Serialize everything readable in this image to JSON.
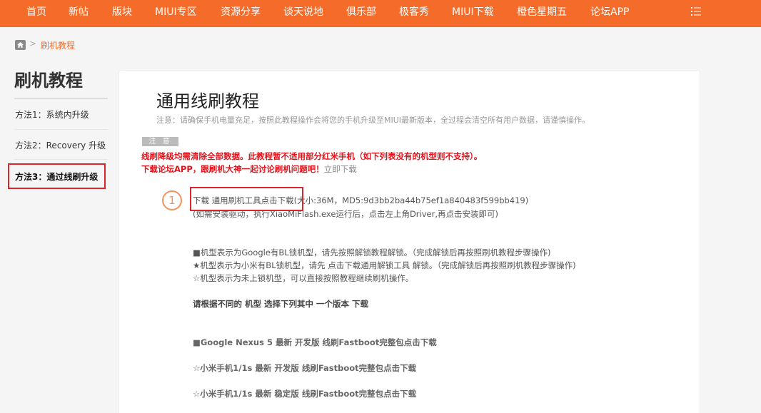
{
  "nav": {
    "items": [
      "首页",
      "新帖",
      "版块",
      "MIUI专区",
      "资源分享",
      "谈天说地",
      "俱乐部",
      "极客秀",
      "MIUI下载",
      "橙色星期五",
      "论坛APP"
    ],
    "menu_icon": "menu-list-icon"
  },
  "breadcrumb": {
    "home_icon": "home-icon",
    "separator": ">",
    "current": "刷机教程"
  },
  "sidebar": {
    "title": "刷机教程",
    "items": [
      {
        "label": "方法1：系统内升级"
      },
      {
        "label": "方法2：Recovery 升级"
      },
      {
        "label": "方法3：通过线刷升级"
      }
    ]
  },
  "main": {
    "title": "通用线刷教程",
    "notice": "注意：请确保手机电量充足，按照此教程操作会将您的手机升级至MIUI最新版本，全过程会清空所有用户数据，请谨慎操作。",
    "badge": "注 意",
    "warning_1": "线刷降级均需清除全部数据。此教程暂不适用部分红米手机（如下列表没有的机型则不支持）。",
    "warning_2_text": "下载论坛APP，跟刷机大神一起讨论刷机问题吧！",
    "warning_2_link": "立即下载",
    "step_number": "1",
    "step_line_1_prefix": "下载 ",
    "step_line_1_link": "通用刷机工具点击下载",
    "step_line_1_suffix": "(大小:36M，MD5:9d3bb2ba44b75ef1a840483f599bb419)",
    "step_line_2": "(如需安装驱动，执行XiaoMiFlash.exe运行后，点击左上角Driver,再点击安装即可)",
    "lock_1_prefix": "■机型表示为Google有BL锁机型，请先按照",
    "lock_1_link": "解锁教程",
    "lock_1_suffix": "解锁。（完成解锁后再按照刷机教程步骤操作)",
    "lock_2_prefix": "★机型表示为小米有BL锁机型，请先 ",
    "lock_2_link": "点击下载通用解锁工具",
    "lock_2_suffix": " 解锁。（完成解锁后再按照刷机教程步骤操作)",
    "lock_3": "☆机型表示为未上锁机型，可以直接按照教程继续刷机操作。",
    "choose": "请根据不同的 机型 选择下列其中 一个版本 下载",
    "downloads": [
      "■Google Nexus 5 最新 开发版 线刷Fastboot完整包点击下载",
      "☆小米手机1/1s 最新 开发版 线刷Fastboot完整包点击下载",
      "☆小米手机1/1s 最新 稳定版 线刷Fastboot完整包点击下载"
    ]
  },
  "colors": {
    "brand": "#f56b2a",
    "highlight": "#d9262c",
    "warning": "#e4131b",
    "step": "#f5925a"
  }
}
